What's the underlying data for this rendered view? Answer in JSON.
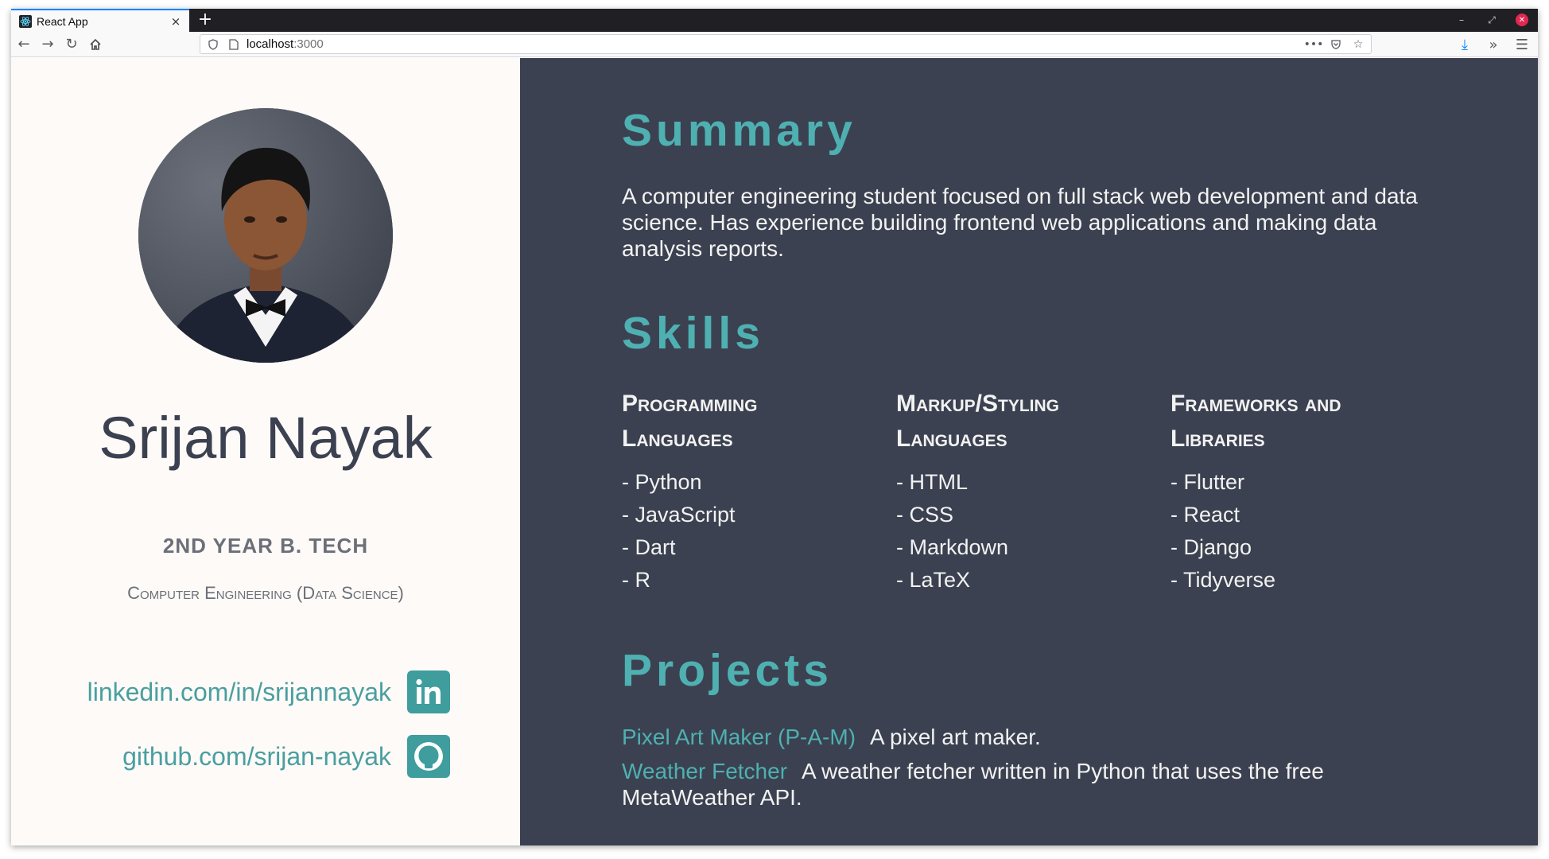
{
  "browser": {
    "tab_title": "React App",
    "tab_close": "×",
    "new_tab": "+",
    "url_host": "localhost",
    "url_port": ":3000"
  },
  "profile": {
    "name": "Srijan Nayak",
    "year": "2ND YEAR B. TECH",
    "department": "Computer Engineering (Data Science)"
  },
  "social": {
    "linkedin": "linkedin.com/in/srijannayak",
    "github": "github.com/srijan-nayak"
  },
  "summary": {
    "heading": "Summary",
    "text": "A computer engineering student focused on full stack web development and data science. Has experience building frontend web applications and making data analysis reports."
  },
  "skills": {
    "heading": "Skills",
    "columns": [
      {
        "title": "Programming Languages",
        "items": [
          "- Python",
          "- JavaScript",
          "- Dart",
          "- R"
        ]
      },
      {
        "title": "Markup/Styling Languages",
        "items": [
          "- HTML",
          "- CSS",
          "- Markdown",
          "- LaTeX"
        ]
      },
      {
        "title": "Frameworks and Libraries",
        "items": [
          "- Flutter",
          "- React",
          "- Django",
          "- Tidyverse"
        ]
      }
    ]
  },
  "projects": {
    "heading": "Projects",
    "items": [
      {
        "name": "Pixel Art Maker (P-A-M)",
        "description": "A pixel art maker."
      },
      {
        "name": "Weather Fetcher",
        "description": "A weather fetcher written in Python that uses the free MetaWeather API."
      }
    ]
  },
  "colors": {
    "accent": "#4fb0b2",
    "dark_panel": "#3b4150",
    "light_panel": "#fdfaf7"
  }
}
